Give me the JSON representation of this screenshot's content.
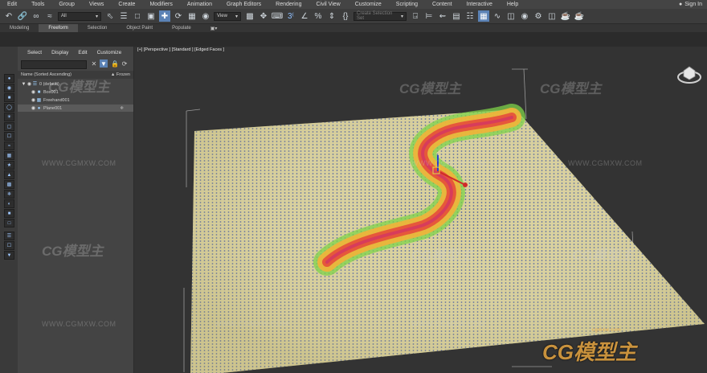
{
  "menubar": {
    "items": [
      "Edit",
      "Tools",
      "Group",
      "Views",
      "Create",
      "Modifiers",
      "Animation",
      "Graph Editors",
      "Rendering",
      "Civil View",
      "Customize",
      "Scripting",
      "Content",
      "Interactive",
      "Help"
    ],
    "signin": "Sign In"
  },
  "toolbar": {
    "filter_value": "All",
    "view_value": "View",
    "selection_set_placeholder": "Create Selection Set"
  },
  "ribbon": {
    "tabs": [
      "Modeling",
      "Freeform",
      "Selection",
      "Object Paint",
      "Populate"
    ],
    "active": "Freeform"
  },
  "scene_explorer": {
    "menu": [
      "Select",
      "Display",
      "Edit",
      "Customize"
    ],
    "column_name": "Name (Sorted Ascending)",
    "column_frozen": "▲ Frozen",
    "items": [
      {
        "name": "0 (default)",
        "level": 0
      },
      {
        "name": "Box001",
        "level": 1
      },
      {
        "name": "Freehand001",
        "level": 1
      },
      {
        "name": "Plane001",
        "level": 1
      }
    ]
  },
  "viewport": {
    "label": "[+] [Perspective ] [Standard ] [Edged Faces ]"
  },
  "watermarks": {
    "logo_text": "CG模型主",
    "url_text": "WWW.CGMXW.COM",
    "small_url": "cgmxw.com"
  },
  "colors": {
    "plane": "#c9c08a",
    "heat_hot": "#e5483a",
    "heat_warm": "#f2b33a",
    "heat_cool": "#7fd34a",
    "accent": "#5b82b5"
  }
}
